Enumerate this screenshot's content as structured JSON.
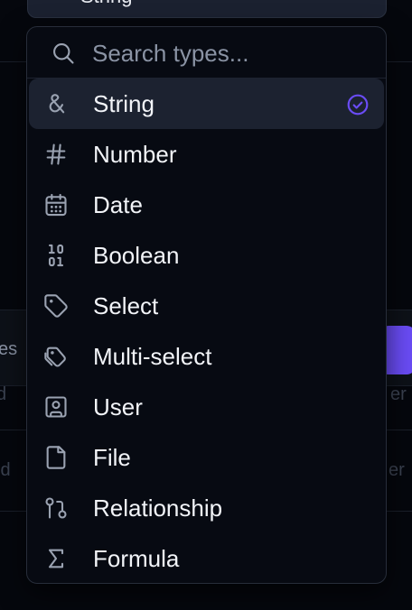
{
  "trigger": {
    "label": "String"
  },
  "search": {
    "placeholder": "Search types..."
  },
  "types": [
    {
      "label": "String",
      "icon": "ampersand-icon",
      "selected": true
    },
    {
      "label": "Number",
      "icon": "hash-icon"
    },
    {
      "label": "Date",
      "icon": "calendar-icon"
    },
    {
      "label": "Boolean",
      "icon": "binary-icon"
    },
    {
      "label": "Select",
      "icon": "tag-icon"
    },
    {
      "label": "Multi-select",
      "icon": "tags-icon"
    },
    {
      "label": "User",
      "icon": "user-square-icon"
    },
    {
      "label": "File",
      "icon": "file-icon"
    },
    {
      "label": "Relationship",
      "icon": "git-pull-request-icon"
    },
    {
      "label": "Formula",
      "icon": "sigma-icon"
    }
  ],
  "colors": {
    "accent": "#6a4cf5",
    "panel_bg": "#070a12",
    "selected_bg": "#1c2230",
    "text": "#f2f4f8",
    "muted": "#8a93a4"
  }
}
